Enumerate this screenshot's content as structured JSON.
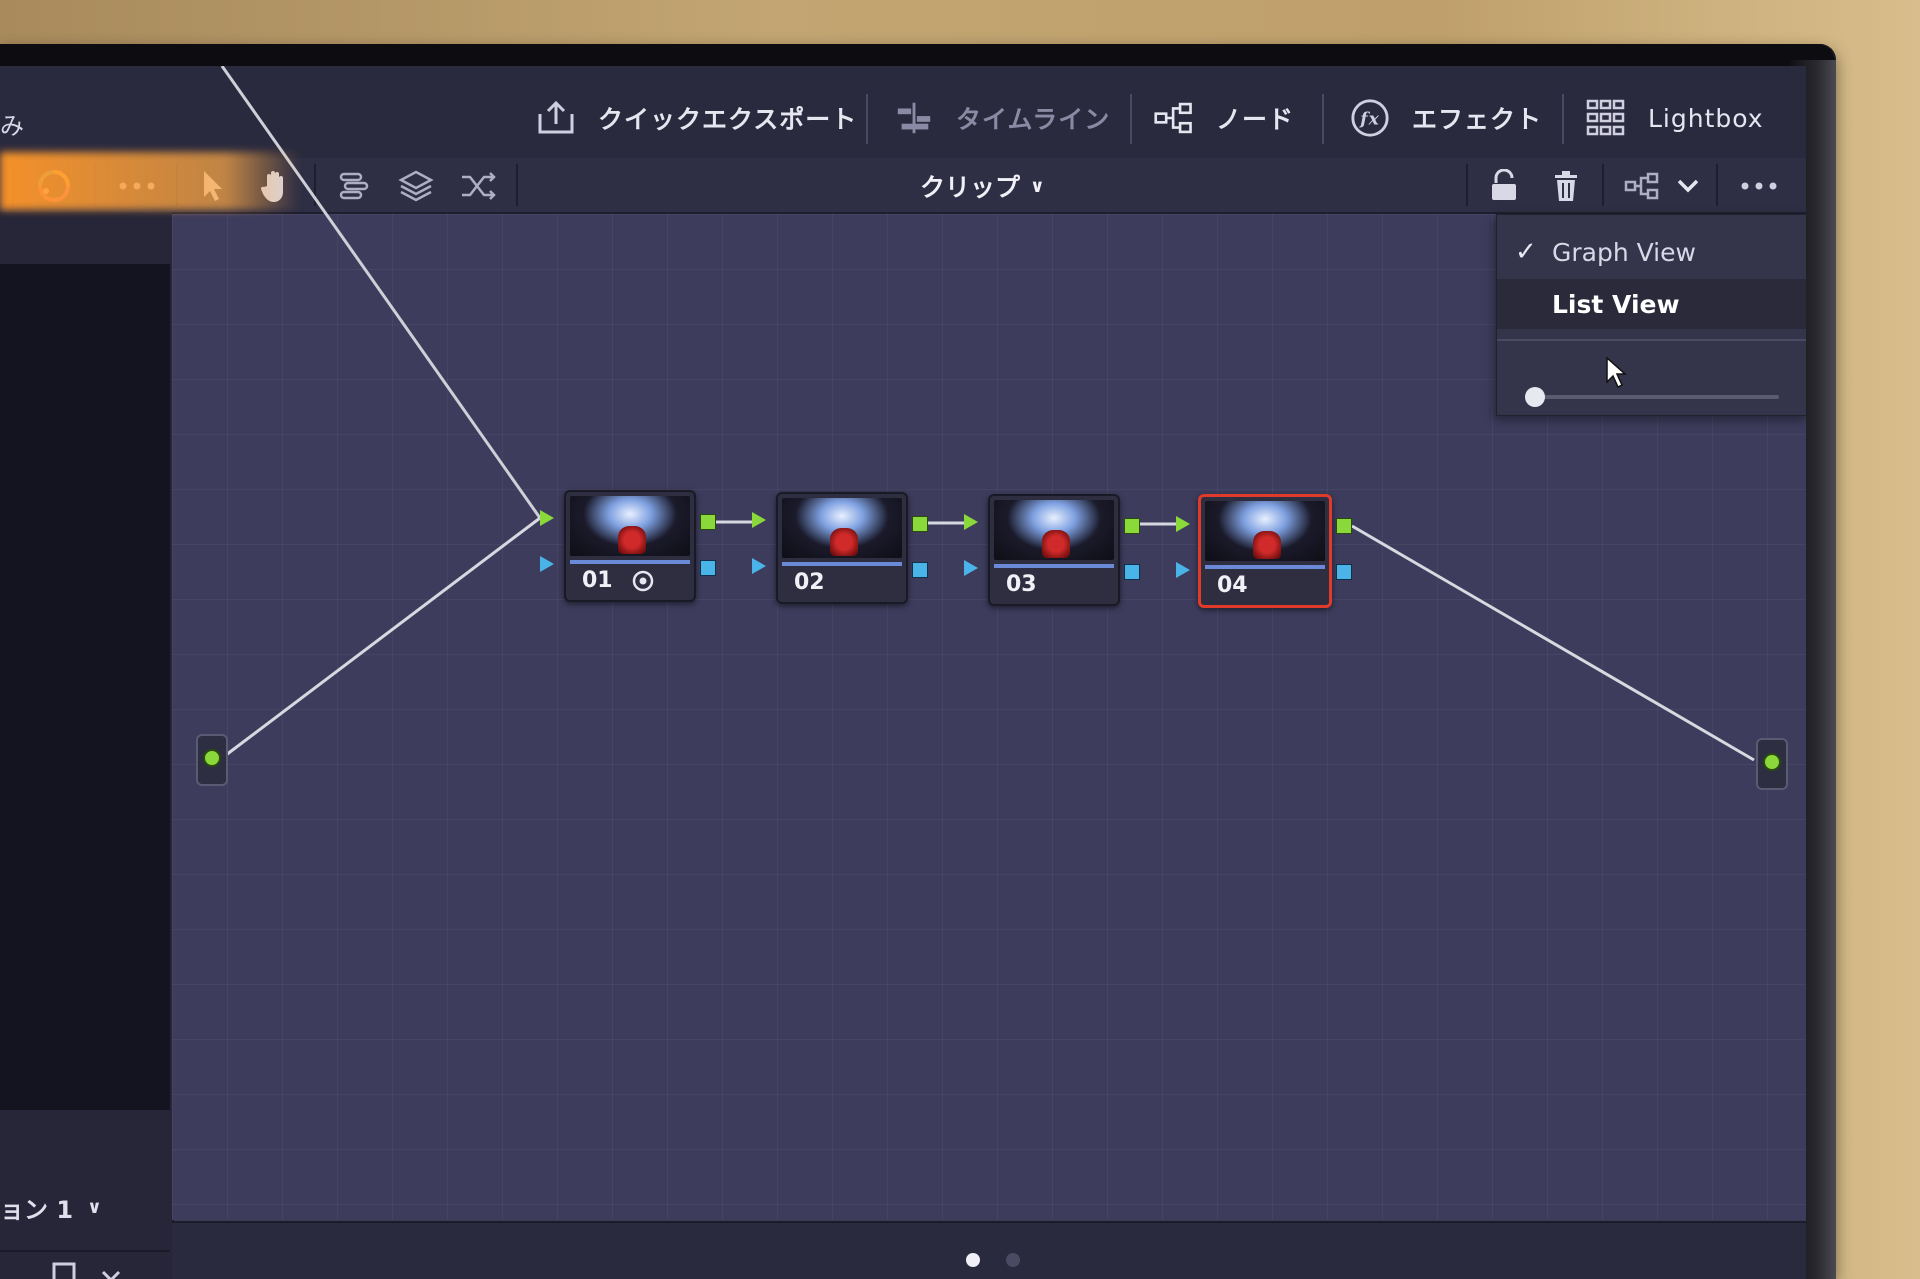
{
  "topbar": {
    "partial_label": "み",
    "items": [
      {
        "label": "クイックエクスポート",
        "icon": "export-icon"
      },
      {
        "label": "タイムライン",
        "icon": "timeline-icon"
      },
      {
        "label": "ノード",
        "icon": "nodes-icon"
      },
      {
        "label": "エフェクト",
        "icon": "fx-icon"
      },
      {
        "label": "Lightbox",
        "icon": "lightbox-grid-icon"
      }
    ]
  },
  "toolbar": {
    "clip_selector": "クリップ",
    "tools": [
      "color-wheel-icon",
      "more-icon",
      "pointer-icon",
      "hand-icon",
      "align-icon",
      "layers-icon",
      "shuffle-icon"
    ],
    "right_tools": [
      "lock-icon",
      "trash-icon",
      "node-view-icon",
      "chevron-down-icon",
      "more-icon"
    ]
  },
  "left_panel": {
    "selector": "ョン 1",
    "bottom_icon": "bookmark-icon"
  },
  "nodes": [
    {
      "label": "01",
      "selected": false,
      "has_icon": true
    },
    {
      "label": "02",
      "selected": false,
      "has_icon": false
    },
    {
      "label": "03",
      "selected": false,
      "has_icon": false
    },
    {
      "label": "04",
      "selected": true,
      "has_icon": false
    }
  ],
  "menu": {
    "items": [
      {
        "label": "Graph View",
        "checked": true
      },
      {
        "label": "List View",
        "checked": false
      }
    ],
    "slider_value": 0
  },
  "pagination": {
    "pages": 2,
    "current": 1
  },
  "colors": {
    "port_green": "#8ad83a",
    "port_blue": "#4ab4e8",
    "selected_node_border": "#e03a2a",
    "canvas": "#3d3c5c"
  }
}
